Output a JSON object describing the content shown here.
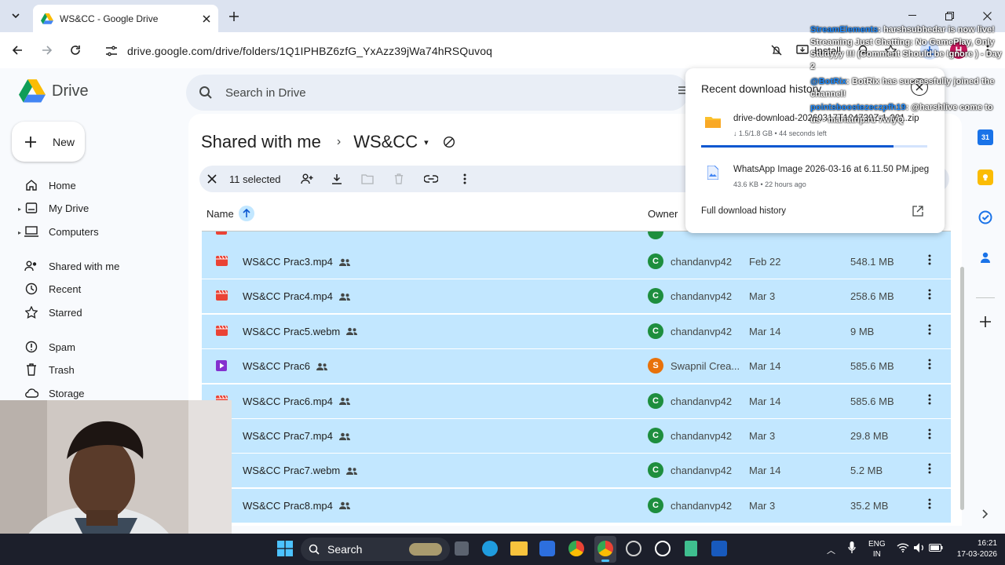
{
  "browser": {
    "tab_title": "WS&CC - Google Drive",
    "url": "drive.google.com/drive/folders/1Q1IPHBZ6zfG_YxAzz39jWa74hRSQuvoq",
    "install_label": "Install",
    "profile_initial": "H"
  },
  "drive": {
    "logo_text": "Drive",
    "search_placeholder": "Search in Drive",
    "new_label": "New",
    "nav": [
      "Home",
      "My Drive",
      "Computers",
      "Shared with me",
      "Recent",
      "Starred",
      "Spam",
      "Trash",
      "Storage"
    ],
    "breadcrumb_root": "Shared with me",
    "breadcrumb_current": "WS&CC",
    "selected_count": "11 selected",
    "col_name": "Name",
    "col_owner": "Owner",
    "files": [
      {
        "name": "WS&CC Prac3.mp4",
        "type": "video",
        "owner": "chandanvp42",
        "initial": "C",
        "date": "Feb 22",
        "size": "548.1 MB",
        "color": "#1e8e3e"
      },
      {
        "name": "WS&CC Prac4.mp4",
        "type": "video",
        "owner": "chandanvp42",
        "initial": "C",
        "date": "Mar 3",
        "size": "258.6 MB",
        "color": "#1e8e3e"
      },
      {
        "name": "WS&CC Prac5.webm",
        "type": "video",
        "owner": "chandanvp42",
        "initial": "C",
        "date": "Mar 14",
        "size": "9 MB",
        "color": "#1e8e3e"
      },
      {
        "name": "WS&CC Prac6",
        "type": "vid",
        "owner": "Swapnil Crea...",
        "initial": "S",
        "date": "Mar 14",
        "size": "585.6 MB",
        "color": "#e8710a"
      },
      {
        "name": "WS&CC Prac6.mp4",
        "type": "video",
        "owner": "chandanvp42",
        "initial": "C",
        "date": "Mar 14",
        "size": "585.6 MB",
        "color": "#1e8e3e"
      },
      {
        "name": "WS&CC Prac7.mp4",
        "type": "video",
        "owner": "chandanvp42",
        "initial": "C",
        "date": "Mar 3",
        "size": "29.8 MB",
        "color": "#1e8e3e"
      },
      {
        "name": "WS&CC Prac7.webm",
        "type": "video",
        "owner": "chandanvp42",
        "initial": "C",
        "date": "Mar 14",
        "size": "5.2 MB",
        "color": "#1e8e3e"
      },
      {
        "name": "WS&CC Prac8.mp4",
        "type": "video",
        "owner": "chandanvp42",
        "initial": "C",
        "date": "Mar 3",
        "size": "35.2 MB",
        "color": "#1e8e3e"
      }
    ]
  },
  "downloads": {
    "title": "Recent download history",
    "items": [
      {
        "name": "drive-download-20260317T104730Z-1-001.zip",
        "meta": "↓ 1.5/1.8 GB • 44 seconds left",
        "progress": 0.85
      },
      {
        "name": "WhatsApp Image 2026-03-16 at 6.11.50 PM.jpeg",
        "meta": "43.6 KB • 22 hours ago"
      }
    ],
    "full_history": "Full download history"
  },
  "chat": [
    {
      "user": "StreamElements",
      "text": ": harshsubhedar is now live! Streaming Just Chatting: No GamePlay, Only Studyyy !!! (Comment Should be Ignore ) - Day 2"
    },
    {
      "user": "@BotRix",
      "text": ": BotRix has successfully joined the channel!"
    },
    {
      "user": "pointsboostezeczpfh19",
      "text": ": @harshlive come to us - mariatrip.ru 7wlyQ"
    }
  ],
  "taskbar": {
    "search_label": "Search",
    "lang1": "ENG",
    "lang2": "IN",
    "time": "16:21",
    "date": "17-03-2026"
  }
}
